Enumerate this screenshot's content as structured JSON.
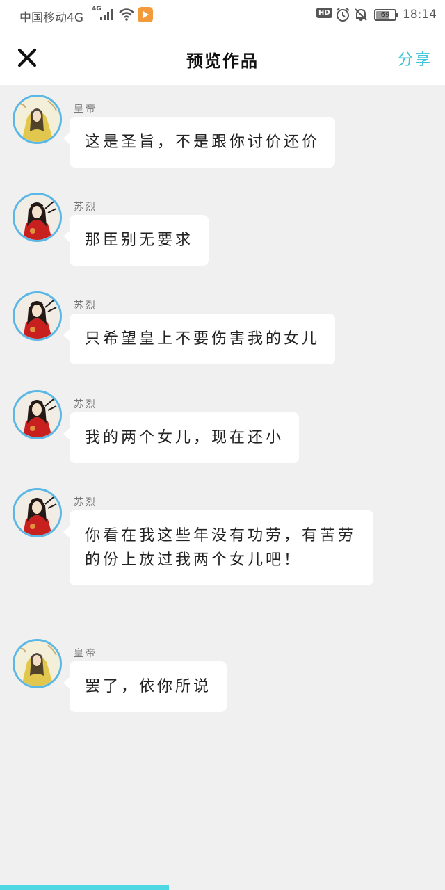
{
  "status_bar": {
    "carrier": "中国移动4G",
    "network_badge": "4G",
    "hd_badge": "HD",
    "battery_level": "69",
    "time": "18:14"
  },
  "header": {
    "close_icon": "close-icon",
    "title": "预览作品",
    "share_label": "分享"
  },
  "messages": [
    {
      "sender": "皇帝",
      "avatar": "emperor",
      "text": "这是圣旨，不是跟你讨价还价"
    },
    {
      "sender": "苏烈",
      "avatar": "red-robe",
      "text": "那臣别无要求"
    },
    {
      "sender": "苏烈",
      "avatar": "red-robe",
      "text": "只希望皇上不要伤害我的女儿"
    },
    {
      "sender": "苏烈",
      "avatar": "red-robe",
      "text": "我的两个女儿，现在还小"
    },
    {
      "sender": "苏烈",
      "avatar": "red-robe",
      "text": "你看在我这些年没有功劳，有苦劳的份上放过我两个女儿吧！"
    },
    {
      "sender": "皇帝",
      "avatar": "emperor",
      "text": "罢了，依你所说"
    }
  ],
  "colors": {
    "accent": "#3cc4dc",
    "avatar_ring": "#5bb8e6",
    "background": "#f0f0f0",
    "progress": "#4fd8e4"
  },
  "progress_fraction": 0.38
}
